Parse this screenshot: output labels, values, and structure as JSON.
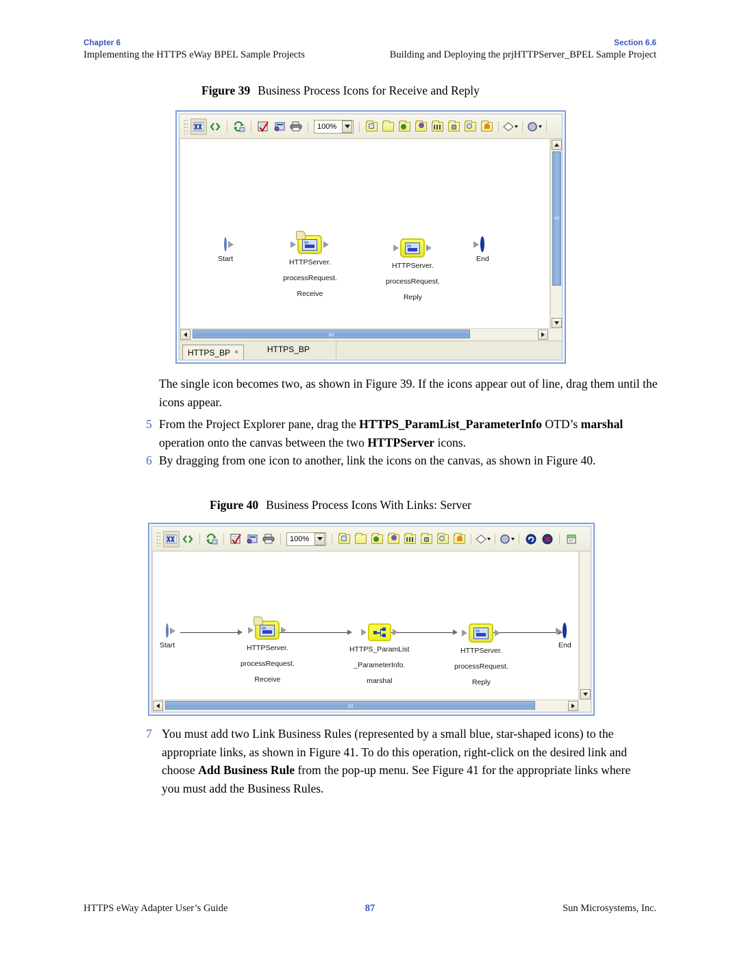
{
  "runhead": {
    "left_label": "Chapter 6",
    "left_text": "Implementing the HTTPS eWay BPEL Sample Projects",
    "right_label": "Section 6.6",
    "right_text": "Building and Deploying the prjHTTPServer_BPEL Sample Project"
  },
  "figure39": {
    "caption_prefix": "Figure 39",
    "caption_title": "Business Process Icons for Receive and Reply",
    "toolbar": {
      "zoom_value": "100%",
      "icons": [
        "validate-icon",
        "code-brackets-icon",
        "synchronize-icon",
        "checkmark-form-icon",
        "properties-icon",
        "print-icon"
      ],
      "palette_icons": [
        "activity-folder-icon",
        "empty-folder-icon",
        "scope-folder-icon",
        "invoke-folder-icon",
        "while-folder-icon",
        "assign-folder-icon",
        "receive-folder-icon",
        "reply-folder-icon"
      ],
      "decision-icon": "diamond-decision-icon",
      "event-icon": "circle-event-icon"
    },
    "nodes": [
      {
        "name": "Start",
        "type": "start",
        "lines": [
          "Start"
        ]
      },
      {
        "name": "Receive",
        "type": "activity",
        "lines": [
          "HTTPServer.",
          "processRequest.",
          "Receive"
        ]
      },
      {
        "name": "Reply",
        "type": "activity",
        "lines": [
          "HTTPServer.",
          "processRequest.",
          "Reply"
        ]
      },
      {
        "name": "End",
        "type": "end",
        "lines": [
          "End"
        ]
      }
    ],
    "tabs": {
      "active_tab": "HTTPS_BP",
      "close_glyph": "×",
      "secondary_tab": "HTTPS_BP"
    }
  },
  "figure40": {
    "caption_prefix": "Figure 40",
    "caption_title": "Business Process Icons With Links: Server",
    "toolbar": {
      "zoom_value": "100%",
      "extra_icons": [
        "refresh-circle-icon",
        "stop-circle-icon",
        "new-document-icon"
      ]
    },
    "nodes": [
      {
        "name": "Start",
        "type": "start",
        "lines": [
          "Start"
        ]
      },
      {
        "name": "Receive",
        "type": "activity",
        "lines": [
          "HTTPServer.",
          "processRequest.",
          "Receive"
        ]
      },
      {
        "name": "Marshal",
        "type": "otd",
        "lines": [
          "HTTPS_ParamList",
          "_ParameterInfo.",
          "marshal"
        ]
      },
      {
        "name": "Reply",
        "type": "activity",
        "lines": [
          "HTTPServer.",
          "processRequest.",
          "Reply"
        ]
      },
      {
        "name": "End",
        "type": "end",
        "lines": [
          "End"
        ]
      }
    ]
  },
  "body": {
    "intro": "The single icon becomes two, as shown in Figure 39. If the icons appear out of line, drag them until the icons appear.",
    "step5_num": "5",
    "step5_a": "From the Project Explorer pane, drag the ",
    "step5_b": "HTTPS_ParamList_ParameterInfo",
    "step5_c": " OTD’s ",
    "step5_d": "marshal",
    "step5_e": " operation onto the canvas between the two ",
    "step5_f": "HTTPServer",
    "step5_g": " icons.",
    "step6_num": "6",
    "step6_text": "By dragging from one icon to another, link the icons on the canvas, as shown in Figure 40.",
    "step7_num": "7",
    "step7_a": "You must add two Link Business Rules (represented by a small blue, star-shaped icons) to the appropriate links, as shown in Figure 41. To do this operation, right-click on the desired link and choose ",
    "step7_b": "Add Business Rule",
    "step7_c": " from the pop-up menu. See Figure 41 for the appropriate links where you must add the Business Rules."
  },
  "footer": {
    "left": "HTTPS eWay Adapter User’s Guide",
    "page": "87",
    "right": "Sun Microsystems, Inc."
  }
}
